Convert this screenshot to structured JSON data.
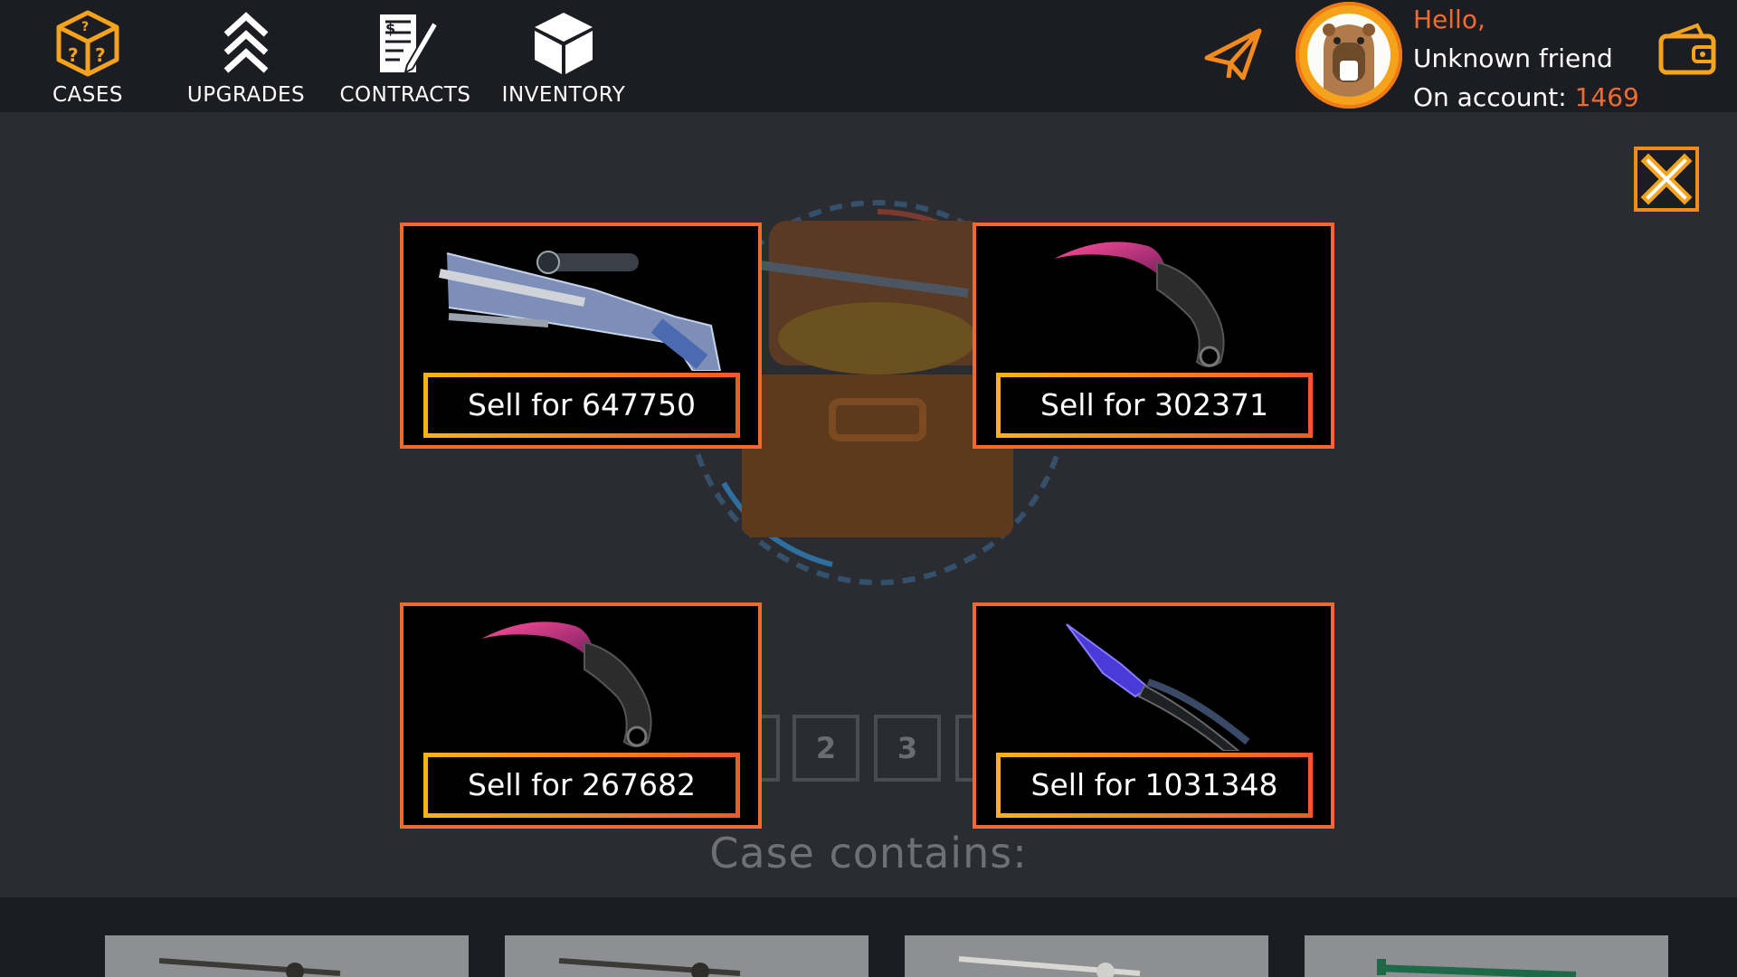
{
  "nav": [
    {
      "label": "CASES",
      "icon": "question-box-icon"
    },
    {
      "label": "UPGRADES",
      "icon": "chevrons-up-icon"
    },
    {
      "label": "CONTRACTS",
      "icon": "contract-document-icon"
    },
    {
      "label": "INVENTORY",
      "icon": "cube-icon"
    }
  ],
  "user": {
    "greeting": "Hello,",
    "name": "Unknown friend",
    "account_label": "On account: ",
    "balance": "1469"
  },
  "pager": [
    "2",
    "3"
  ],
  "drops": [
    {
      "item": "sniper-rifle",
      "sell_label": "Sell for 647750"
    },
    {
      "item": "karambit-knife",
      "sell_label": "Sell for 302371"
    },
    {
      "item": "karambit-knife",
      "sell_label": "Sell for 267682"
    },
    {
      "item": "butterfly-knife",
      "sell_label": "Sell for 1031348"
    }
  ],
  "case_contains_title": "Case contains:",
  "colors": {
    "accent_orange": "#f06a30",
    "gold": "#f7b21a",
    "topbar_bg": "#1b1d23",
    "main_bg": "#2a2c31"
  }
}
